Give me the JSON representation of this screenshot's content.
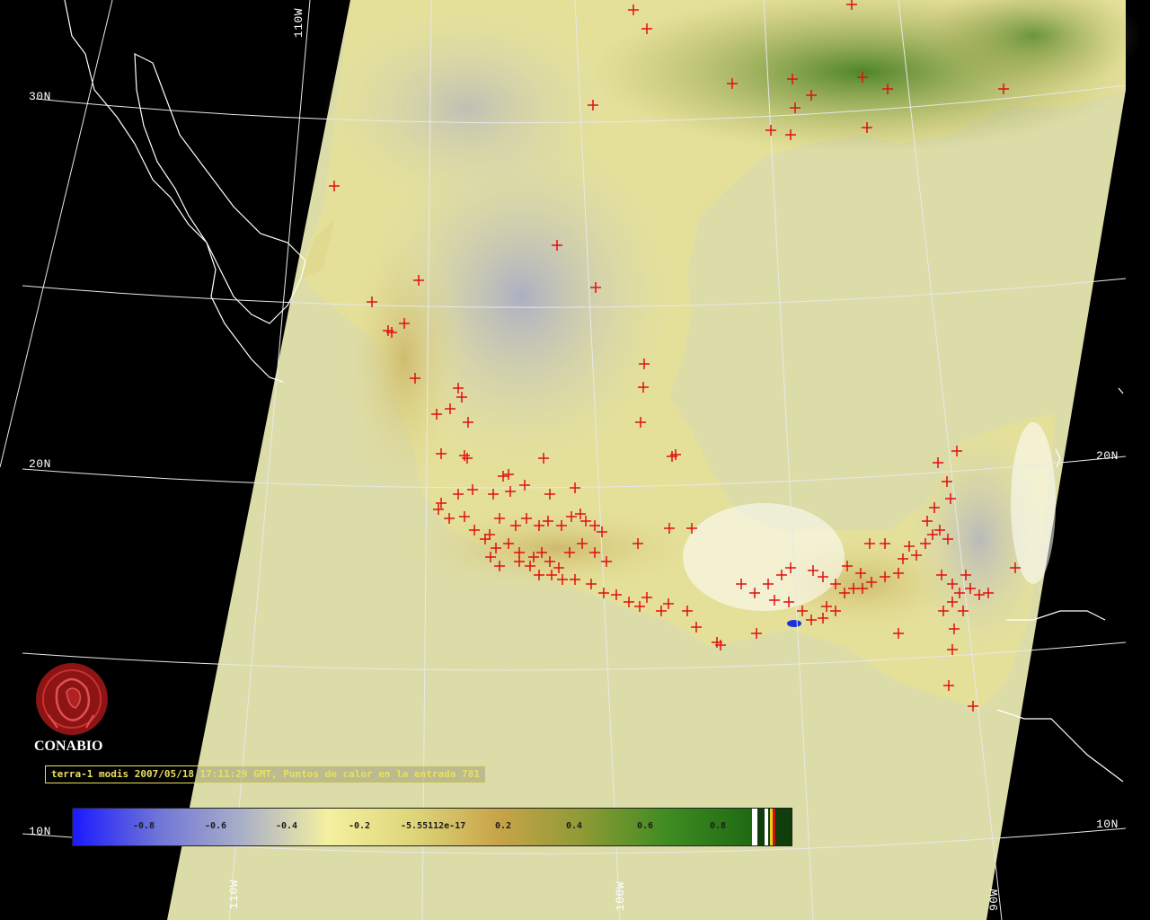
{
  "grid_labels": {
    "lat_30n_left": "30N",
    "lat_20n_left": "20N",
    "lat_20n_right": "20N",
    "lat_10n_left": "10N",
    "lat_10n_right": "10N",
    "lon_110w_top": "110W",
    "lon_110w_bottom": "110W",
    "lon_100w_bottom": "100W",
    "lon_90w_bottom": "90W"
  },
  "logo": {
    "text": "CONABIO"
  },
  "caption": "terra-1 modis 2007/05/18 17:11:29 GMT, Puntos de calor en la entrada 781",
  "colorbar": {
    "labels": [
      "-0.8",
      "-0.6",
      "-0.4",
      "-0.2",
      "-5.55112e-17",
      "0.2",
      "0.4",
      "0.6",
      "0.8"
    ],
    "colors": [
      "#1a1aff",
      "#6f74d8",
      "#aab0c8",
      "#f4f0a0",
      "#ded67a",
      "#c8a44a",
      "#8f9a35",
      "#3f8c22",
      "#1f6a12"
    ]
  },
  "colors": {
    "swath_fill": "#dcdca8",
    "hotspot": "#e01010",
    "grid": "#e8e8e8",
    "background": "#000000"
  }
}
